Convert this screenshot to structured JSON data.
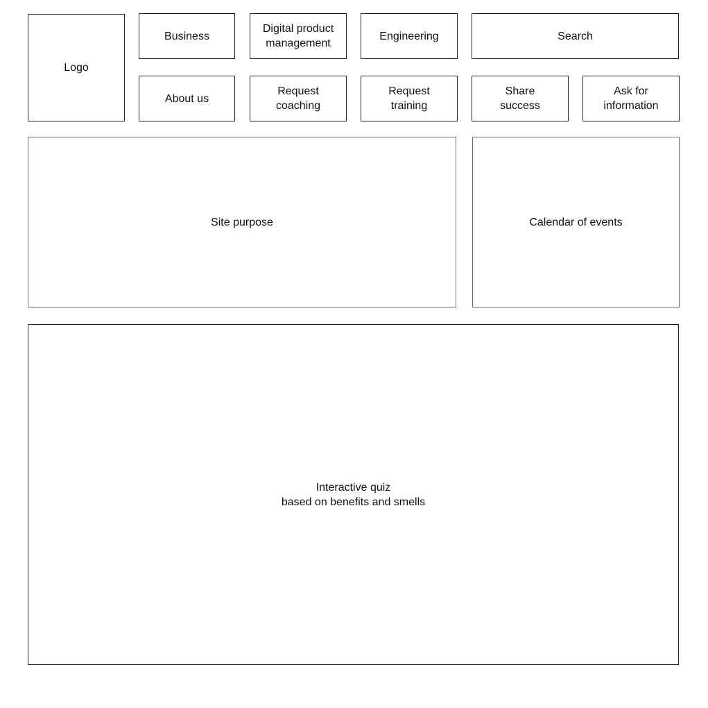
{
  "header": {
    "logo": "Logo",
    "search": "Search",
    "nav_row1": [
      "Business",
      "Digital product\nmanagement",
      "Engineering"
    ],
    "nav_row2": [
      "About us",
      "Request\ncoaching",
      "Request\ntraining",
      "Share\nsuccess",
      "Ask for\ninformation"
    ]
  },
  "main": {
    "site_purpose": "Site purpose",
    "calendar": "Calendar of events",
    "quiz": "Interactive quiz\nbased on benefits and smells"
  }
}
